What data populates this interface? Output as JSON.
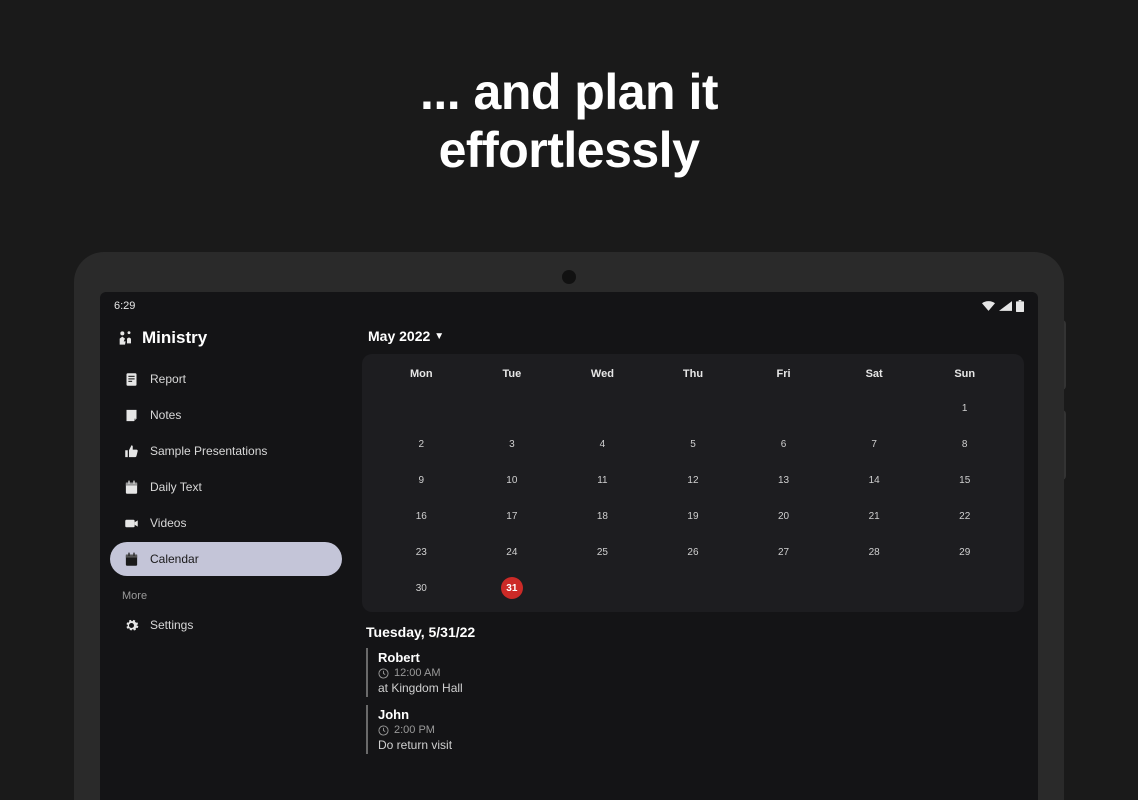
{
  "promo": {
    "line1": "... and plan it",
    "line2": "effortlessly"
  },
  "status": {
    "time": "6:29"
  },
  "app": {
    "title": "Ministry"
  },
  "nav": {
    "items": [
      {
        "label": "Report"
      },
      {
        "label": "Notes"
      },
      {
        "label": "Sample Presentations"
      },
      {
        "label": "Daily Text"
      },
      {
        "label": "Videos"
      },
      {
        "label": "Calendar"
      }
    ],
    "moreLabel": "More",
    "settings": {
      "label": "Settings"
    }
  },
  "calendar": {
    "month": "May 2022",
    "weekdays": [
      "Mon",
      "Tue",
      "Wed",
      "Thu",
      "Fri",
      "Sat",
      "Sun"
    ],
    "selectedDateLabel": "Tuesday, 5/31/22",
    "selectedDay": 31,
    "weeks": [
      [
        "",
        "",
        "",
        "",
        "",
        "",
        "1"
      ],
      [
        "2",
        "3",
        "4",
        "5",
        "6",
        "7",
        "8"
      ],
      [
        "9",
        "10",
        "11",
        "12",
        "13",
        "14",
        "15"
      ],
      [
        "16",
        "17",
        "18",
        "19",
        "20",
        "21",
        "22"
      ],
      [
        "23",
        "24",
        "25",
        "26",
        "27",
        "28",
        "29"
      ],
      [
        "30",
        "31",
        "",
        "",
        "",
        "",
        ""
      ]
    ]
  },
  "events": [
    {
      "name": "Robert",
      "time": "12:00 AM",
      "note": "at Kingdom Hall"
    },
    {
      "name": "John",
      "time": "2:00 PM",
      "note": "Do return visit"
    }
  ]
}
